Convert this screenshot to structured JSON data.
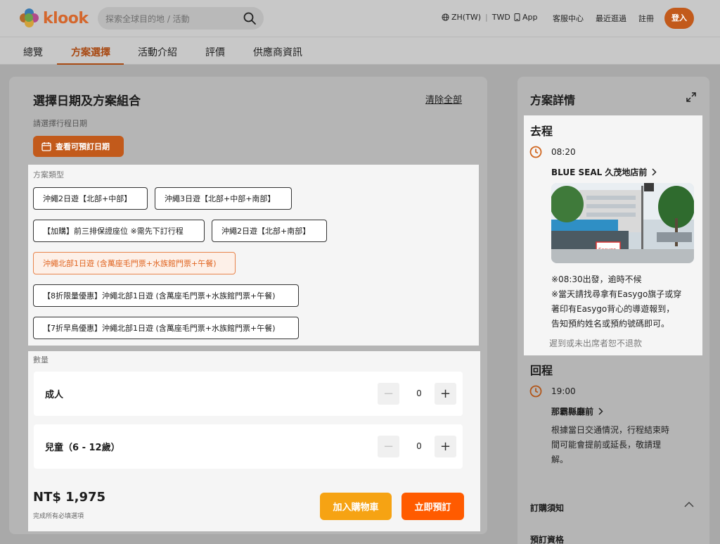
{
  "brand": {
    "name": "klook",
    "accent": "#ff5b00"
  },
  "search": {
    "placeholder": "探索全球目的地 / 活動"
  },
  "top_nav": {
    "language": "ZH(TW)",
    "currency": "TWD",
    "app": "App",
    "help": "客服中心",
    "recent": "最近逛過",
    "register": "註冊",
    "login": "登入"
  },
  "tabs": [
    {
      "label": "總覽",
      "active": false
    },
    {
      "label": "方案選擇",
      "active": true
    },
    {
      "label": "活動介紹",
      "active": false
    },
    {
      "label": "評價",
      "active": false
    },
    {
      "label": "供應商資訊",
      "active": false
    }
  ],
  "booking": {
    "title": "選擇日期及方案組合",
    "clear_all": "清除全部",
    "date_label": "請選擇行程日期",
    "date_button": "查看可預訂日期",
    "package_label": "方案類型",
    "packages": [
      {
        "label": "沖繩2日遊【北部+中部】",
        "selected": false
      },
      {
        "label": "沖繩3日遊【北部+中部+南部】",
        "selected": false
      },
      {
        "label": "【加購】前三排保證座位 ※需先下訂行程",
        "selected": false
      },
      {
        "label": "沖繩2日遊【北部+南部】",
        "selected": false
      },
      {
        "label": "沖繩北部1日遊 (含萬座毛門票+水族館門票+午餐)",
        "selected": true
      },
      {
        "label": "【8折限量優惠】沖繩北部1日遊 (含萬座毛門票+水族館門票+午餐)",
        "selected": false
      },
      {
        "label": "【7折早鳥優惠】沖繩北部1日遊 (含萬座毛門票+水族館門票+午餐)",
        "selected": false
      }
    ],
    "quantity_label": "數量",
    "quantities": [
      {
        "label": "成人",
        "value": "0"
      },
      {
        "label": "兒童（6 - 12歲）",
        "value": "0"
      }
    ],
    "price": "NT$ 1,975",
    "price_note": "完成所有必填選項",
    "add_to_cart": "加入購物車",
    "book_now": "立即預訂"
  },
  "details": {
    "title": "方案詳情",
    "outbound": {
      "title": "去程",
      "time": "08:20",
      "place": "BLUE SEAL 久茂地店前",
      "notes": [
        "※08:30出發，逾時不候",
        "※當天請找尋拿有Easygo旗子或穿",
        "著印有Easygo背心的導遊報到，",
        "告知預約姓名或預約號碼即可。"
      ],
      "no_show": "遲到或未出席者恕不退款"
    },
    "return": {
      "title": "回程",
      "time": "19:00",
      "place": "那霸縣廳前",
      "notes": [
        "根據當日交通情況，行程結束時",
        "間可能會提前或延長，敬請理",
        "解。"
      ]
    },
    "order_notice": "訂購須知",
    "order_sub": "預訂資格"
  }
}
